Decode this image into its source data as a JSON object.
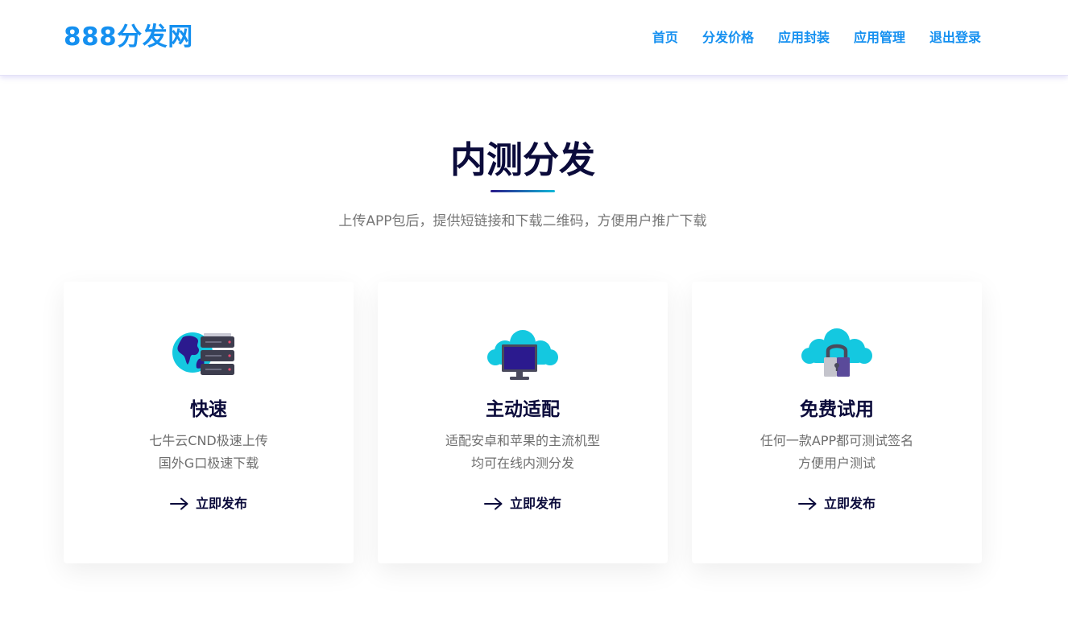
{
  "header": {
    "brand": "888分发网",
    "nav": [
      "首页",
      "分发价格",
      "应用封装",
      "应用管理",
      "退出登录"
    ]
  },
  "hero": {
    "title": "内测分发",
    "subtitle": "上传APP包后，提供短链接和下载二维码，方便用户推广下载"
  },
  "cards": [
    {
      "icon": "globe-server-icon",
      "title": "快速",
      "line1": "七牛云CND极速上传",
      "line2": "国外G口极速下载",
      "cta": "立即发布"
    },
    {
      "icon": "cloud-monitor-icon",
      "title": "主动适配",
      "line1": "适配安卓和苹果的主流机型",
      "line2": "均可在线内测分发",
      "cta": "立即发布"
    },
    {
      "icon": "cloud-lock-icon",
      "title": "免费试用",
      "line1": "任何一款APP都可测试签名",
      "line2": "方便用户测试",
      "cta": "立即发布"
    }
  ],
  "colors": {
    "brand_blue": "#1590f0",
    "heading_navy": "#0b0b3b",
    "body_gray": "#6e6e6e",
    "cloud_cyan": "#14c8e0",
    "monitor_purple": "#2b1a8e"
  }
}
